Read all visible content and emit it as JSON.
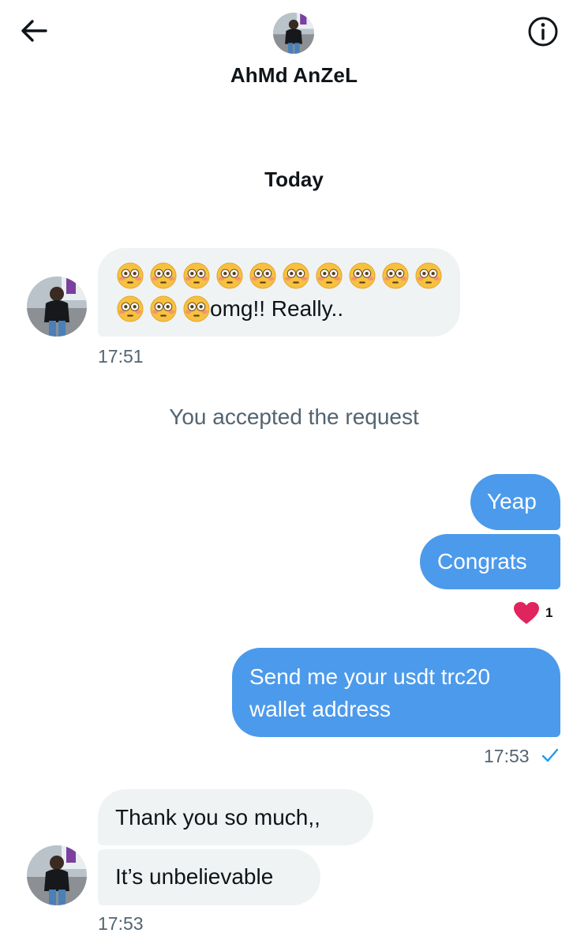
{
  "header": {
    "title": "AhMd AnZeL",
    "back_icon": "arrow-left-icon",
    "info_icon": "info-circle-icon"
  },
  "date_separator": "Today",
  "messages": [
    {
      "direction": "in",
      "emoji": "flushed-face",
      "emoji_count_line1": 10,
      "emoji_count_line2": 3,
      "text": "omg!! Really..",
      "time": "17:51"
    }
  ],
  "system_message": "You accepted the request",
  "outgoing": {
    "bubble1": "Yeap",
    "bubble2": "Congrats",
    "reaction_count": "1",
    "bubble3_line1": "Send me your usdt trc20",
    "bubble3_line2": "wallet address",
    "time": "17:53"
  },
  "incoming_last": {
    "bubble1": "Thank you so much,,",
    "bubble2": "It’s unbelievable",
    "time": "17:53"
  },
  "colors": {
    "outgoing_bubble": "#4c9aeb",
    "incoming_bubble": "#eff3f4",
    "secondary_text": "#536471",
    "heart": "#e0245e",
    "check": "#1d9bf0"
  }
}
